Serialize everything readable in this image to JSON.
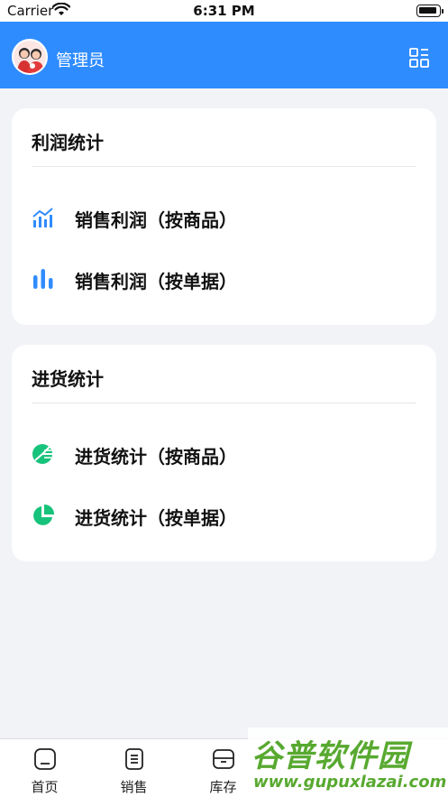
{
  "status_bar": {
    "carrier": "Carrier",
    "time": "6:31 PM"
  },
  "header": {
    "title": "管理员",
    "avatar_icon": "avatar-icon",
    "menu_icon": "grid-icon"
  },
  "profit_card": {
    "title": "利润统计",
    "items": [
      {
        "label": "销售利润（按商品）",
        "icon": "trend-chart-icon",
        "color": "#2f8cff"
      },
      {
        "label": "销售利润（按单据）",
        "icon": "bar-chart-icon",
        "color": "#2f8cff"
      }
    ]
  },
  "purchase_card": {
    "title": "进货统计",
    "items": [
      {
        "label": "进货统计（按商品）",
        "icon": "pie-segments-icon",
        "color": "#17c37b"
      },
      {
        "label": "进货统计（按单据）",
        "icon": "pie-chart-icon",
        "color": "#17c37b"
      }
    ]
  },
  "tabbar": {
    "tabs": [
      {
        "label": "首页",
        "icon": "home-icon"
      },
      {
        "label": "销售",
        "icon": "clipboard-icon"
      },
      {
        "label": "库存",
        "icon": "archive-box-icon"
      }
    ]
  },
  "watermark": {
    "logo": "谷普软件园",
    "url": "www.gupuxlazai.com"
  },
  "colors": {
    "primary": "#2f8cff",
    "green": "#17c37b",
    "background": "#f2f3f7"
  }
}
